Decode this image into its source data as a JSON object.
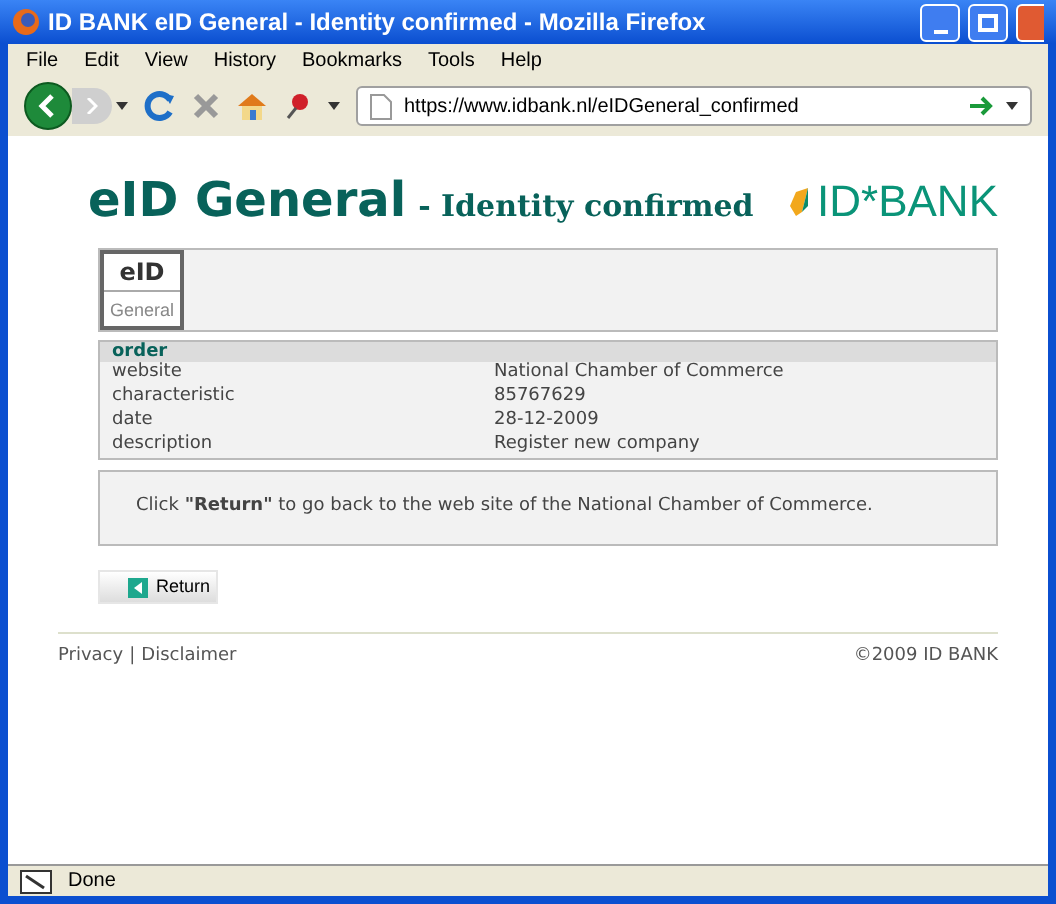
{
  "window": {
    "title": "ID BANK eID General - Identity confirmed - Mozilla Firefox"
  },
  "menu": [
    "File",
    "Edit",
    "View",
    "History",
    "Bookmarks",
    "Tools",
    "Help"
  ],
  "address_bar": {
    "url": "https://www.idbank.nl/eIDGeneral_confirmed"
  },
  "page": {
    "heading": "eID General",
    "subheading": "- Identity confirmed",
    "logo": "ID*BANK",
    "badge": {
      "top": "eID",
      "bottom": "General"
    },
    "order": {
      "title": "order",
      "rows": [
        {
          "label": "website",
          "value": "National Chamber of Commerce"
        },
        {
          "label": "characteristic",
          "value": "85767629"
        },
        {
          "label": "date",
          "value": "28-12-2009"
        },
        {
          "label": "description",
          "value": "Register new company"
        }
      ]
    },
    "message": "Click **\"Return\"** to go back to the web site of the National Chamber of Commerce.",
    "return_button": "Return",
    "footer": {
      "links": [
        "Privacy",
        "Disclaimer"
      ],
      "separator": "|",
      "copyright": "©2009 ID BANK"
    }
  },
  "status_bar": {
    "text": "Done"
  }
}
